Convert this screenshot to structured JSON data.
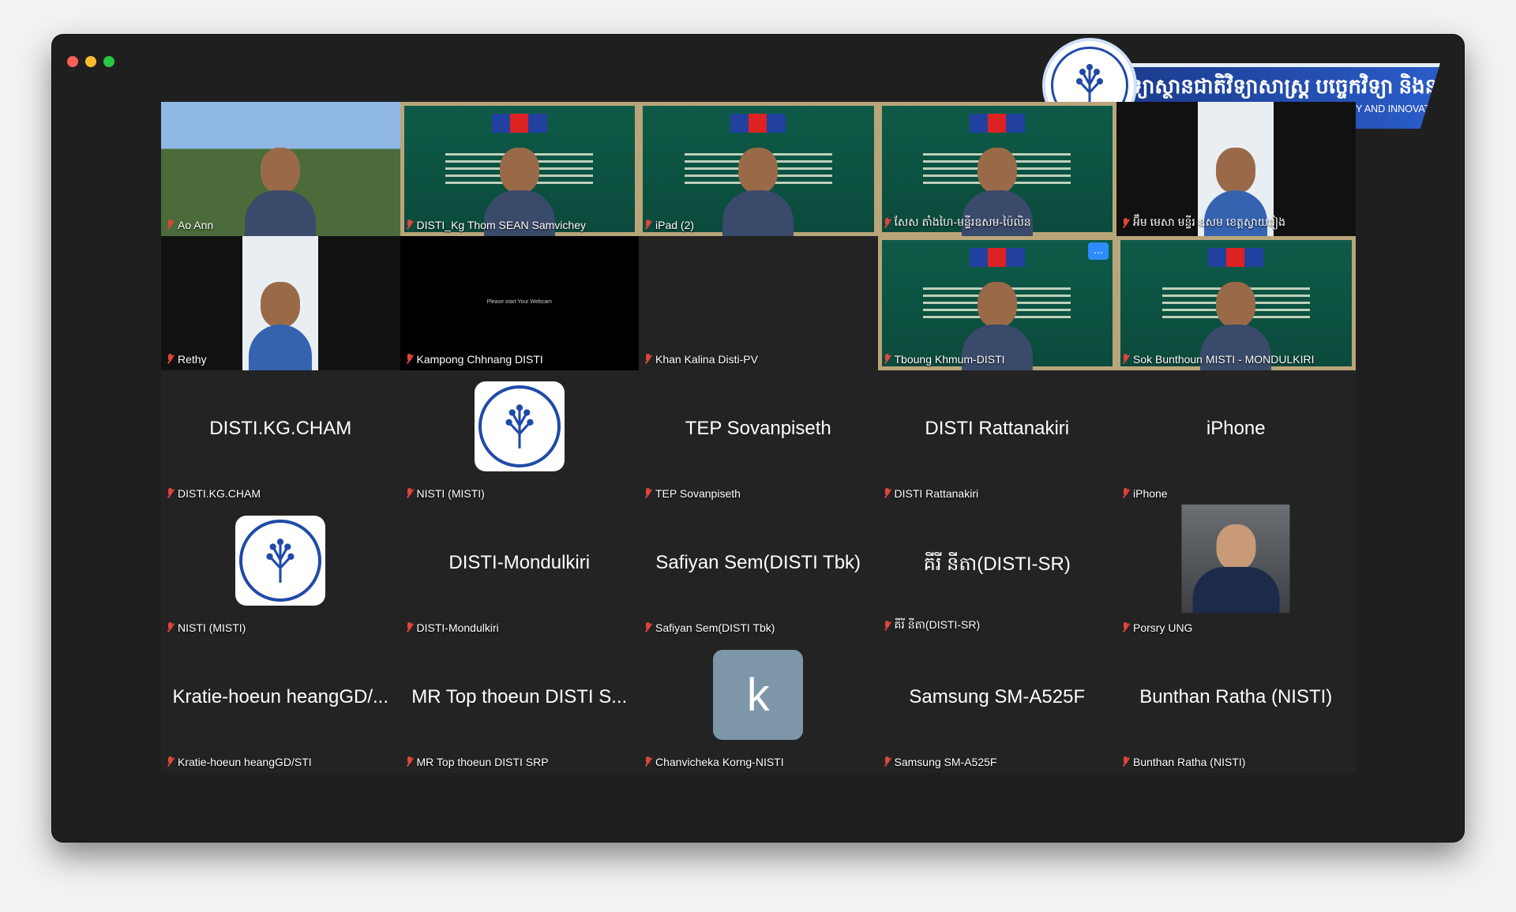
{
  "window": {
    "traffic_lights": [
      "close",
      "minimize",
      "zoom"
    ]
  },
  "banner": {
    "khmer_title": "វិទ្យាស្ថានជាតិវិទ្យាសាស្ត្រ បច្ចេកវិទ្យា និងនវានុវត្តន៍",
    "english_title": "NATIONAL INSTITUTE OF SCIENCE, TECHNOLOGY AND INNOVATION"
  },
  "colors": {
    "muted_mic": "#e0453a",
    "tile_bg": "#232323",
    "window_bg": "#1f1f20",
    "more_button": "#2d8cff"
  },
  "participants": [
    {
      "label": "Ao Ann",
      "type": "video-sky"
    },
    {
      "label": "DISTI_Kg Thom SEAN Samvichey",
      "type": "video-green"
    },
    {
      "label": "iPad (2)",
      "type": "video-green"
    },
    {
      "label": "សែស តាំងហៃ-មន្ទីរ​ឧសម-ប៉ៃលិន",
      "type": "video-green"
    },
    {
      "label": "អ៊ឹម មេសា មន្ទីរ ឧសម ខេត្តស្វាយរៀង",
      "type": "video-portrait"
    },
    {
      "label": "Rethy",
      "type": "video-portrait"
    },
    {
      "label": "Kampong Chhnang DISTI",
      "type": "video-black",
      "overlay_text": "Please start Your Webcam"
    },
    {
      "label": "Khan Kalina Disti-PV",
      "type": "empty"
    },
    {
      "label": "Tboung Khmum-DISTI",
      "type": "video-green",
      "more_button": "..."
    },
    {
      "label": "Sok Bunthoun MISTI - MONDULKIRI",
      "type": "video-green"
    },
    {
      "label": "DISTI.KG.CHAM",
      "display": "DISTI.KG.CHAM",
      "type": "name"
    },
    {
      "label": "NISTI (MISTI)",
      "type": "logo"
    },
    {
      "label": "TEP Sovanpiseth",
      "display": "TEP Sovanpiseth",
      "type": "name"
    },
    {
      "label": "DISTI Rattanakiri",
      "display": "DISTI Rattanakiri",
      "type": "name"
    },
    {
      "label": "iPhone",
      "display": "iPhone",
      "type": "name"
    },
    {
      "label": "NISTI (MISTI)",
      "type": "logo"
    },
    {
      "label": "DISTI-Mondulkiri",
      "display": "DISTI-Mondulkiri",
      "type": "name"
    },
    {
      "label": "Safiyan Sem(DISTI Tbk)",
      "display": "Safiyan Sem(DISTI Tbk)",
      "type": "name"
    },
    {
      "label": "គីរី នីតា(DISTI-SR)",
      "display": "គីរី នីតា(DISTI-SR)",
      "type": "name"
    },
    {
      "label": "Porsry UNG",
      "type": "photo"
    },
    {
      "label": "Kratie-hoeun heangGD/STI",
      "display": "Kratie-hoeun heangGD/...",
      "type": "name"
    },
    {
      "label": "MR Top thoeun  DISTI SRP",
      "display": "MR Top thoeun  DISTI S...",
      "type": "name"
    },
    {
      "label": "Chanvicheka Korng-NISTI",
      "avatar_letter": "k",
      "type": "letter"
    },
    {
      "label": "Samsung SM-A525F",
      "display": "Samsung SM-A525F",
      "type": "name"
    },
    {
      "label": "Bunthan Ratha (NISTI)",
      "display": "Bunthan Ratha (NISTI)",
      "type": "name"
    }
  ]
}
